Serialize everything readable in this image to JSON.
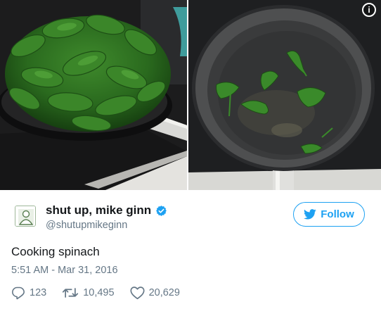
{
  "media": {
    "left_image": "spinach-pile-in-pan",
    "right_image": "wilted-spinach-in-pan",
    "info_icon": "info-icon",
    "info_glyph": "i"
  },
  "author": {
    "display_name": "shut up, mike ginn",
    "handle": "@shutupmikeginn",
    "verified": true,
    "avatar_icon": "default-avatar-icon"
  },
  "follow": {
    "label": "Follow",
    "icon": "twitter-bird-icon",
    "color": "#1da1f2"
  },
  "tweet": {
    "text": "Cooking spinach",
    "timestamp": "5:51 AM - Mar 31, 2016"
  },
  "actions": {
    "replies": "123",
    "retweets": "10,495",
    "likes": "20,629"
  },
  "colors": {
    "text": "#14171a",
    "muted": "#657786",
    "brand": "#1da1f2"
  }
}
